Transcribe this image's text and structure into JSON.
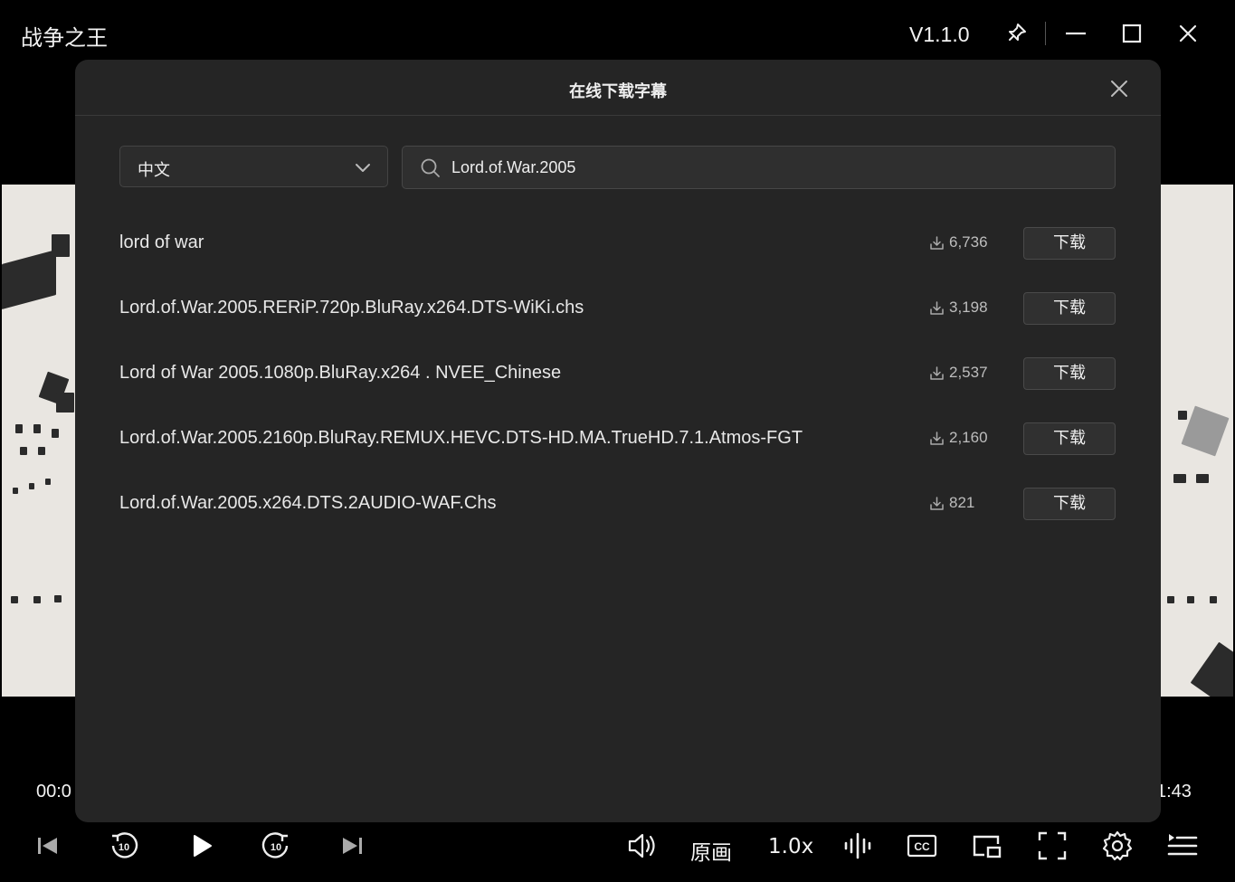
{
  "window": {
    "title": "战争之王",
    "version": "V1.1.0",
    "icons": [
      "pin-icon",
      "minimize-icon",
      "maximize-icon",
      "close-icon"
    ]
  },
  "player": {
    "time_current": "00:0",
    "time_total": "1:43",
    "quality_label": "原画",
    "speed_label": "1.0x"
  },
  "dialog": {
    "title": "在线下载字幕",
    "language": "中文",
    "search_value": "Lord.of.War.2005",
    "download_label": "下载",
    "results": [
      {
        "name": "lord of war",
        "downloads": "6,736"
      },
      {
        "name": "Lord.of.War.2005.RERiP.720p.BluRay.x264.DTS-WiKi.chs",
        "downloads": "3,198"
      },
      {
        "name": "Lord of War 2005.1080p.BluRay.x264 . NVEE_Chinese",
        "downloads": "2,537"
      },
      {
        "name": "Lord.of.War.2005.2160p.BluRay.REMUX.HEVC.DTS-HD.MA.TrueHD.7.1.Atmos-FGT",
        "downloads": "2,160"
      },
      {
        "name": "Lord.of.War.2005.x264.DTS.2AUDIO-WAF.Chs",
        "downloads": "821"
      }
    ]
  },
  "colors": {
    "background": "#000000",
    "dialog_bg": "#252525",
    "video_bg": "#e9e6e1",
    "text": "#e8e8e8"
  }
}
